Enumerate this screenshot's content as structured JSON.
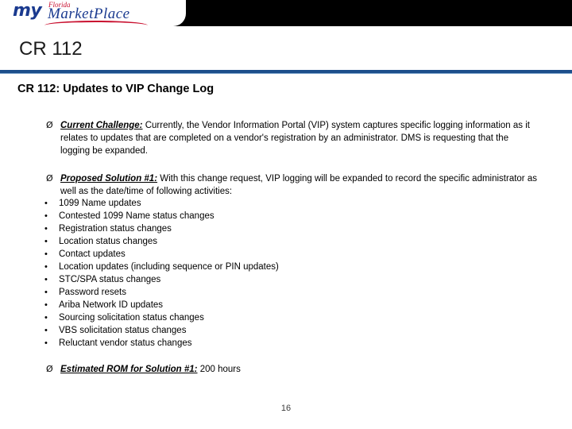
{
  "banner": {
    "logo": {
      "my": "my",
      "florida": "Florida",
      "market_place": "MarketPlace"
    }
  },
  "slide": {
    "title": "CR 112",
    "subtitle": "CR 112: Updates to VIP Change Log",
    "page_number": "16",
    "bullets": [
      {
        "marker": "Ø",
        "lead": "Current Challenge:",
        "text": "  Currently, the Vendor Information Portal (VIP) system captures specific logging information as it relates to updates that are completed on a vendor's registration by an administrator.  DMS is requesting that the logging be expanded."
      },
      {
        "marker": "Ø",
        "lead": "Proposed Solution #1:",
        "text": " With this change request, VIP logging will be expanded to record the specific administrator as well as the date/time of following activities:"
      }
    ],
    "sub_bullets": [
      {
        "marker": "•",
        "text": "1099 Name updates"
      },
      {
        "marker": "•",
        "text": "Contested 1099 Name status changes"
      },
      {
        "marker": "•",
        "text": "Registration status changes"
      },
      {
        "marker": "•",
        "text": "Location status changes"
      },
      {
        "marker": "•",
        "text": "Contact updates"
      },
      {
        "marker": "•",
        "text": "Location updates (including sequence or PIN updates)"
      },
      {
        "marker": "•",
        "text": "STC/SPA status changes"
      },
      {
        "marker": "•",
        "text": "Password resets"
      },
      {
        "marker": "•",
        "text": "Ariba Network ID updates"
      },
      {
        "marker": "•",
        "text": "Sourcing solicitation status changes"
      },
      {
        "marker": "•",
        "text": "VBS solicitation status changes"
      },
      {
        "marker": "•",
        "text": "Reluctant vendor status changes"
      }
    ],
    "final_bullet": {
      "marker": "Ø",
      "lead": "Estimated ROM for Solution #1:",
      "text": " 200 hours"
    }
  }
}
